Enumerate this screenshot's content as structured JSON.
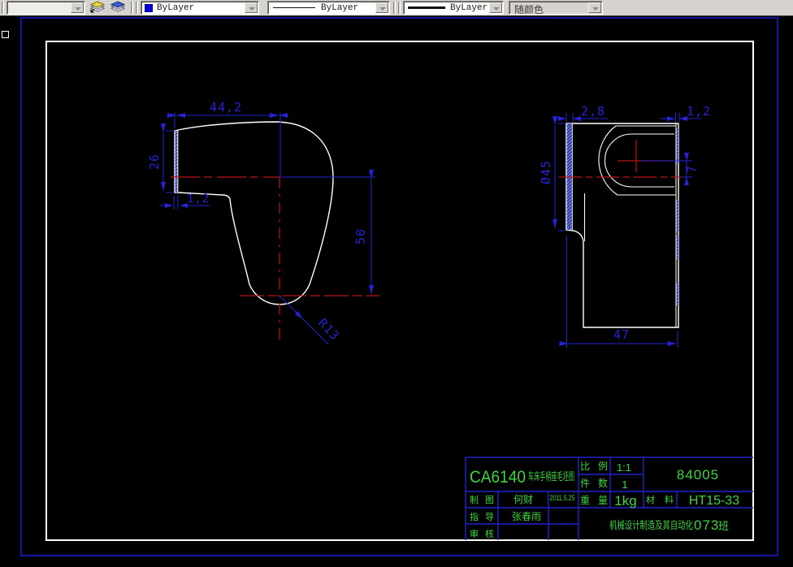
{
  "colors": {
    "toolbar_bg": "#d6d3ce",
    "canvas_bg": "#000000",
    "frame_blue": "#1414a4",
    "frame_white": "#ffffff",
    "geometry": "#ffffff",
    "finish_yellow": "#e9e9a2",
    "dimension_blue": "#2424d4",
    "centerline_red": "#c01212",
    "hatch_blue": "#2434c4",
    "table_grid_blue": "#2222cc",
    "text_green": "#3ed43e",
    "bylayer_swatch": "#0000e0"
  },
  "toolbar": {
    "layer_combo": {
      "value": ""
    },
    "color_combo": {
      "value": "ByLayer"
    },
    "linetype_combo": {
      "value": "ByLayer"
    },
    "lineweight_combo": {
      "value": "ByLayer"
    },
    "plotstyle_combo": {
      "value": "随颜色"
    },
    "icons": {
      "icon1": "make-object-layer-current",
      "icon2": "layer-previous"
    }
  },
  "drawing": {
    "left_view": {
      "dims": {
        "width": "44,2",
        "height": "26",
        "wall": "1,2",
        "drop": "50",
        "radius": "R13"
      }
    },
    "right_view": {
      "dims": {
        "left_wall": "2,8",
        "right_wall": "1,2",
        "diameter": "Ø45",
        "offset": "7",
        "width": "47"
      }
    }
  },
  "title_block": {
    "title_code": "CA6140",
    "title_text": "车床手柄座毛坯图",
    "scale_label": "比 例",
    "scale": "1:1",
    "qty_label": "件 数",
    "qty": "1",
    "drawing_no": "84005",
    "weight_label": "重 量",
    "weight": "1kg",
    "material_label": "材 料",
    "material": "HT15-33",
    "draft_label": "制 图",
    "drafter": "何财",
    "date": "2011.5.25",
    "advisor_label": "指 导",
    "advisor": "张春雨",
    "audit_label": "审 核",
    "dept_prefix": "机械设计制造及其自动化",
    "class_no": "073",
    "class_suffix": "班"
  }
}
